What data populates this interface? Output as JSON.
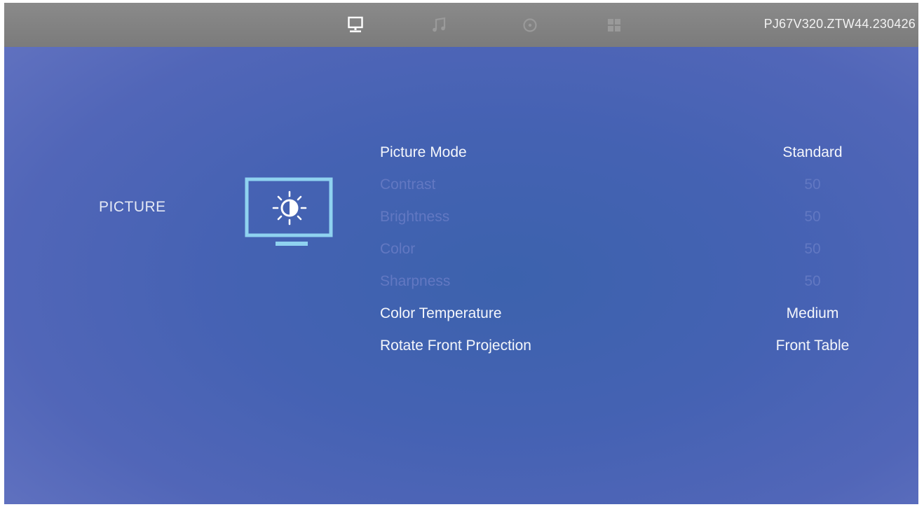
{
  "topbar": {
    "tabs": [
      {
        "icon": "monitor-icon",
        "active": true
      },
      {
        "icon": "music-note-icon",
        "active": false
      },
      {
        "icon": "clock-icon",
        "active": false
      },
      {
        "icon": "grid-icon",
        "active": false
      }
    ],
    "firmware_version": "PJ67V320.ZTW44.230426"
  },
  "category": {
    "label": "PICTURE",
    "icon": "monitor-brightness-icon"
  },
  "menu": {
    "items": [
      {
        "label": "Picture Mode",
        "value": "Standard",
        "enabled": true
      },
      {
        "label": "Contrast",
        "value": "50",
        "enabled": false
      },
      {
        "label": "Brightness",
        "value": "50",
        "enabled": false
      },
      {
        "label": "Color",
        "value": "50",
        "enabled": false
      },
      {
        "label": "Sharpness",
        "value": "50",
        "enabled": false
      },
      {
        "label": "Color Temperature",
        "value": "Medium",
        "enabled": true
      },
      {
        "label": "Rotate Front Projection",
        "value": "Front Table",
        "enabled": true
      }
    ]
  },
  "colors": {
    "accent_icon": "#8fd2f0",
    "active_tab": "#ffffff",
    "inactive_tab": "#9a9a9a",
    "disabled_text": "#6278c2",
    "enabled_text": "#f4f6fb"
  }
}
